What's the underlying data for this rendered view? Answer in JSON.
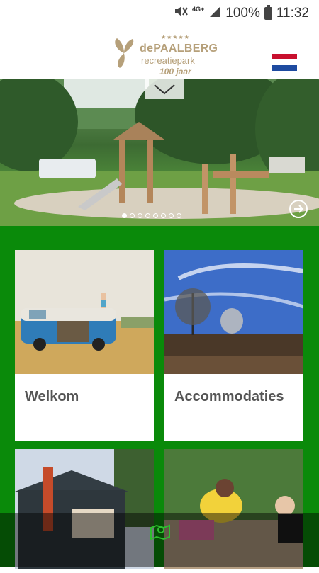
{
  "status_bar": {
    "network": "4G+",
    "battery": "100%",
    "time": "11:32"
  },
  "header": {
    "logo": {
      "name": "dePAALBERG",
      "subtitle": "recreatiepark",
      "badge": "100 jaar"
    },
    "language_flag": "nl-flag-icon"
  },
  "hero": {
    "slide_count": 8,
    "active_slide": 1
  },
  "cards": [
    {
      "title": "Welkom"
    },
    {
      "title": "Accommodaties"
    },
    {
      "title": ""
    },
    {
      "title": ""
    }
  ],
  "colors": {
    "brand_green": "#0a8a0a",
    "logo_gold": "#b6a07a"
  },
  "bottom_bar": {
    "icon": "map-pin-icon"
  }
}
